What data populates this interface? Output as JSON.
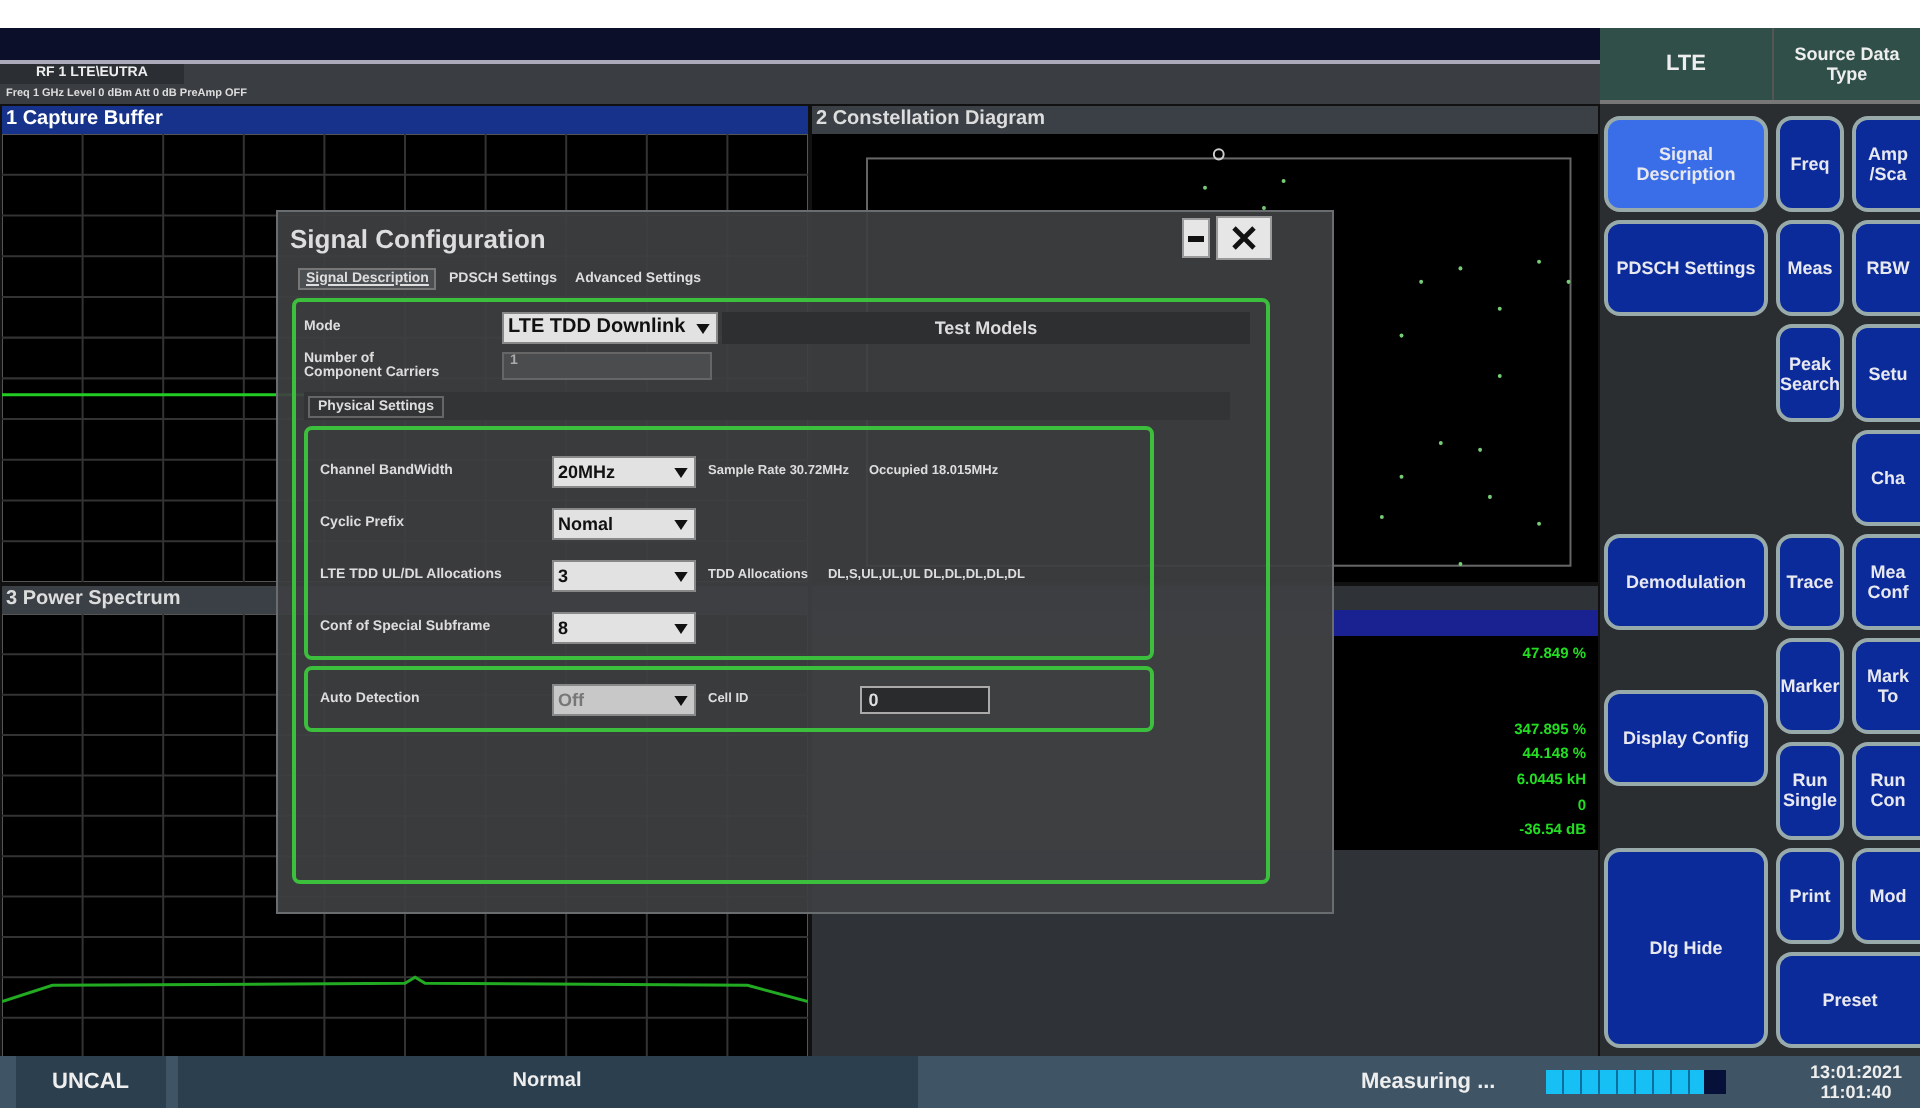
{
  "channel_tab": "RF 1 LTE\\EUTRA",
  "info_line": "Freq 1 GHz Level 0 dBm Att 0 dB PreAmp OFF",
  "panels": {
    "capture_buffer": {
      "title": "1 Capture Buffer",
      "selected": true
    },
    "constellation": {
      "title": "2 Constellation Diagram",
      "selected": false
    },
    "power_spectrum": {
      "title": "3 Power Spectrum",
      "selected": false
    }
  },
  "result_summary": {
    "values": [
      "47.849 %",
      "347.895 %",
      "44.148 %",
      "6.0445 kH",
      "0",
      "-36.54 dB"
    ]
  },
  "dialog": {
    "title": "Signal Configuration",
    "tabs": [
      {
        "label": "Signal Description",
        "selected": true
      },
      {
        "label": "PDSCH Settings",
        "selected": false
      },
      {
        "label": "Advanced Settings",
        "selected": false
      }
    ],
    "mode": {
      "label": "Mode",
      "value": "LTE TDD Downlink"
    },
    "test_models": "Test Models",
    "carriers": {
      "label": "Number of Component Carriers",
      "value": "1",
      "disabled": true
    },
    "physical_settings": "Physical Settings",
    "physical": [
      {
        "label": "Channel BandWidth",
        "value": "20MHz",
        "notes": [
          "Sample Rate 30.72MHz",
          "Occupied 18.015MHz"
        ]
      },
      {
        "label": "Cyclic Prefix",
        "value": "Nomal"
      },
      {
        "label": "LTE TDD UL/DL Allocations",
        "value": "3",
        "notes": [
          "TDD Allocations",
          "DL,S,UL,UL,UL  DL,DL,DL,DL,DL"
        ]
      },
      {
        "label": "Conf of Special Subframe",
        "value": "8"
      }
    ],
    "detection": {
      "label": "Auto Detection",
      "value": "Off",
      "disabled": true,
      "cell_id_label": "Cell ID",
      "cell_id": "0"
    }
  },
  "softkeys": {
    "headers": [
      "LTE",
      "Source Data Type"
    ],
    "column_1": [
      {
        "label": "Signal Description",
        "selected": true
      },
      {
        "label": "PDSCH Settings",
        "selected": false
      },
      {
        "label": "Demodulation",
        "selected": false
      },
      {
        "label": "Display Config",
        "selected": false
      },
      {
        "label": "Dlg Hide",
        "selected": false
      }
    ],
    "column_2": [
      "Freq",
      "Meas",
      "Peak Search",
      "Trace",
      "Marker",
      "Run Single",
      "Print"
    ],
    "column_3": [
      "Amp /Sca",
      "RBW",
      "Setu",
      "Cha",
      "Mea Conf",
      "Mark To",
      "Run Con",
      "Mod"
    ],
    "wide": "Preset"
  },
  "status_bar": {
    "uncal": "UNCAL",
    "mode": "Normal",
    "state": "Measuring ...",
    "progress": {
      "level": 0.88
    },
    "date": "13:01:2021",
    "time": "11:01:40"
  }
}
